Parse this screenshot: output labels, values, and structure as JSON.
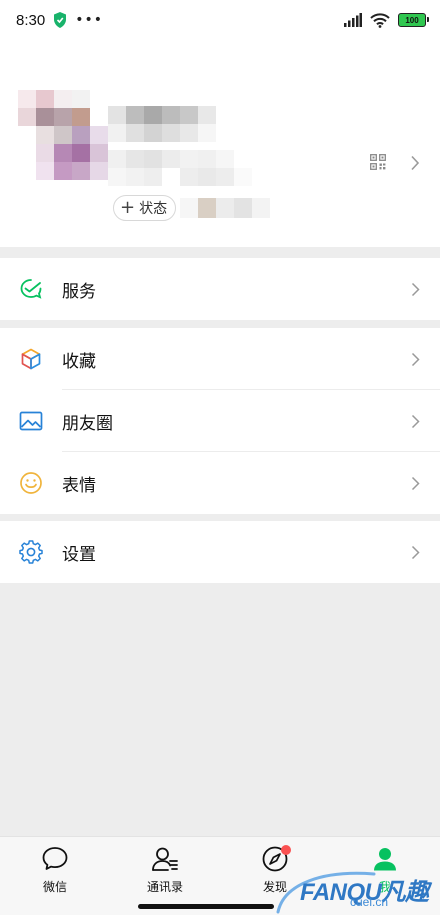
{
  "status_bar": {
    "time": "8:30",
    "dots": "•••",
    "battery": "100"
  },
  "profile": {
    "status_button_label": "状态",
    "status_plus": "+"
  },
  "groups": [
    {
      "rows": [
        {
          "label": "服务",
          "icon": "service-icon",
          "color": "#07c160"
        }
      ]
    },
    {
      "rows": [
        {
          "label": "收藏",
          "icon": "favorites-cube-icon",
          "color": "#f4a62a"
        },
        {
          "label": "朋友圈",
          "icon": "moments-picture-icon",
          "color": "#2782d7"
        },
        {
          "label": "表情",
          "icon": "sticker-smiley-icon",
          "color": "#f0b43c"
        }
      ]
    },
    {
      "rows": [
        {
          "label": "设置",
          "icon": "settings-gear-icon",
          "color": "#2782d7"
        }
      ]
    }
  ],
  "tabbar": {
    "tabs": [
      {
        "label": "微信",
        "icon": "chat-bubble-icon"
      },
      {
        "label": "通讯录",
        "icon": "contacts-icon"
      },
      {
        "label": "发现",
        "icon": "discover-compass-icon"
      },
      {
        "label": "我",
        "icon": "me-person-icon"
      }
    ],
    "active_color": "#07c160"
  },
  "watermark": {
    "main": "FANQU凡趣",
    "sub": "cuel.cn"
  }
}
